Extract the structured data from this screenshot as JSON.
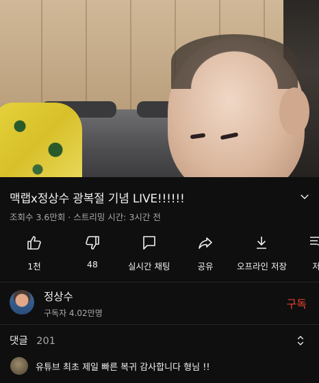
{
  "video": {
    "title": "맥랩x정상수 광복절 기념 LIVE!!!!!!",
    "views": "조회수 3.6만회",
    "meta_separator": "·",
    "streaming": "스트리밍 시간: 3시간 전"
  },
  "actions": [
    {
      "label": "1천",
      "icon": "thumbs-up-icon"
    },
    {
      "label": "48",
      "icon": "thumbs-down-icon"
    },
    {
      "label": "실시간 채팅",
      "icon": "live-chat-icon"
    },
    {
      "label": "공유",
      "icon": "share-icon"
    },
    {
      "label": "오프라인 저장",
      "icon": "download-icon"
    },
    {
      "label": "저",
      "icon": "save-icon"
    }
  ],
  "channel": {
    "name": "정상수",
    "subscribers": "구독자 4.02만명",
    "subscribe_label": "구독"
  },
  "comments": {
    "label": "댓글",
    "count": "201",
    "top_comment": "유튜브 최초 제일 빠른 복귀 감사합니다 형님 !!"
  },
  "colors": {
    "background": "#0f0f0f",
    "subscribe": "#e3412d",
    "secondary_text": "#aaaaaa"
  }
}
